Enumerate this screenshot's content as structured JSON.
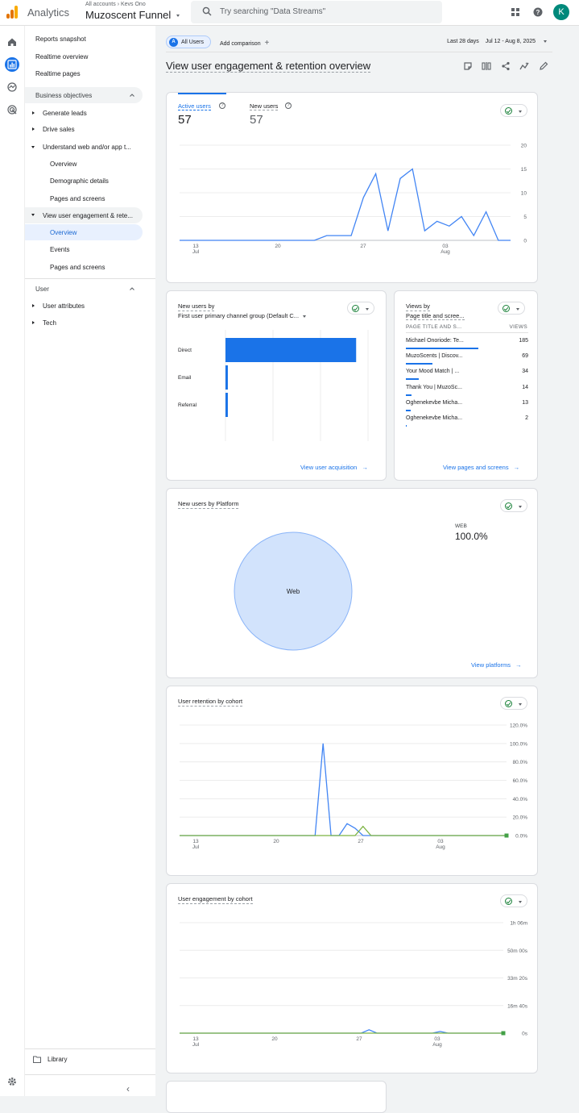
{
  "app": {
    "name": "Analytics",
    "breadcrumb": [
      "All accounts",
      "Kevs Ono"
    ],
    "property": "Muzoscent Funnel",
    "search_placeholder": "Try searching \"Data Streams\"",
    "avatar_letter": "K",
    "logo_colors": [
      "#f9ab00",
      "#e37400",
      "#e37400"
    ]
  },
  "nav": {
    "top_items": [
      "Reports snapshot",
      "Realtime overview",
      "Realtime pages"
    ],
    "business_header": "Business objectives",
    "business_items": [
      "Generate leads",
      "Drive sales",
      "Understand web and/or app t..."
    ],
    "understand_children": [
      "Overview",
      "Demographic details",
      "Pages and screens"
    ],
    "engagement_label": "View user engagement & rete...",
    "engagement_children": [
      "Overview",
      "Events",
      "Pages and screens"
    ],
    "user_header": "User",
    "user_items": [
      "User attributes",
      "Tech"
    ],
    "library": "Library"
  },
  "toolbar": {
    "segment_letter": "A",
    "segment_label": "All Users",
    "add_comparison": "Add comparison",
    "date_label": "Last 28 days",
    "date_range": "Jul 12 - Aug 8, 2025",
    "page_title": "View user engagement & retention overview"
  },
  "overview_card": {
    "metrics": [
      {
        "label": "Active users",
        "value": "57"
      },
      {
        "label": "New users",
        "value": "57"
      }
    ]
  },
  "new_users_card": {
    "title": "New users by",
    "dimension": "First user primary channel group (Default C...",
    "link": "View user acquisition"
  },
  "views_card": {
    "title": "Views by",
    "dimension": "Page title and scree...",
    "col_name": "PAGE TITLE AND S...",
    "col_value": "VIEWS",
    "rows": [
      {
        "name": "Michael Onoriode: Te...",
        "value": "185",
        "share": 1.0
      },
      {
        "name": "MuzoScents | Discov...",
        "value": "69",
        "share": 0.37
      },
      {
        "name": "Your Mood Match | ...",
        "value": "34",
        "share": 0.18
      },
      {
        "name": "Thank You | MuzoSc...",
        "value": "14",
        "share": 0.08
      },
      {
        "name": "Oghenekevbe Micha...",
        "value": "13",
        "share": 0.07
      },
      {
        "name": "Oghenekevbe Micha...",
        "value": "2",
        "share": 0.01
      }
    ],
    "link": "View pages and screens"
  },
  "platform_card": {
    "title": "New users by Platform",
    "legend_label": "WEB",
    "legend_value": "100.0%",
    "slice_label": "Web",
    "link": "View platforms"
  },
  "retention_card": {
    "title": "User retention by cohort"
  },
  "engagement_card": {
    "title": "User engagement by cohort"
  },
  "colors": {
    "blue": "#1a73e8",
    "line_blue": "#4285f4",
    "green": "#7cb342",
    "pie_fill": "#d2e3fc",
    "pie_stroke": "#8ab4f8"
  },
  "chart_data": [
    {
      "type": "line",
      "title": "Active users",
      "x": [
        "Jul 12",
        "Jul 13",
        "Jul 14",
        "Jul 15",
        "Jul 16",
        "Jul 17",
        "Jul 18",
        "Jul 19",
        "Jul 20",
        "Jul 21",
        "Jul 22",
        "Jul 23",
        "Jul 24",
        "Jul 25",
        "Jul 26",
        "Jul 27",
        "Jul 28",
        "Jul 29",
        "Jul 30",
        "Jul 31",
        "Aug 1",
        "Aug 2",
        "Aug 3",
        "Aug 4",
        "Aug 5",
        "Aug 6",
        "Aug 7",
        "Aug 8"
      ],
      "series": [
        {
          "name": "Active users",
          "values": [
            0,
            0,
            0,
            0,
            0,
            0,
            0,
            0,
            0,
            0,
            0,
            0,
            1,
            1,
            1,
            9,
            14,
            2,
            13,
            15,
            2,
            4,
            3,
            5,
            1,
            6,
            0,
            0
          ]
        }
      ],
      "ylim": [
        0,
        20
      ],
      "y_ticks": [
        "20",
        "15",
        "10",
        "5",
        "0"
      ],
      "x_ticks": [
        {
          "day": "13",
          "month": "Jul",
          "index": 1
        },
        {
          "day": "20",
          "index": 8
        },
        {
          "day": "27",
          "index": 15
        },
        {
          "day": "03",
          "month": "Aug",
          "index": 22
        }
      ]
    },
    {
      "type": "bar",
      "title": "New users by First user primary channel group (Default C...",
      "orientation": "horizontal",
      "categories": [
        "Direct",
        "Email",
        "Referral"
      ],
      "values": [
        55,
        1,
        1
      ],
      "xlim": [
        0,
        60
      ],
      "x_ticks": [
        "0",
        "20",
        "40",
        "60"
      ]
    },
    {
      "type": "pie",
      "title": "New users by Platform",
      "categories": [
        "Web"
      ],
      "values": [
        100.0
      ]
    },
    {
      "type": "line",
      "title": "User retention by cohort",
      "x_count": 28,
      "series": [
        {
          "values": [
            0,
            0,
            0,
            0,
            0,
            0,
            0,
            0,
            0,
            0,
            0,
            0,
            0,
            0,
            0,
            0,
            0,
            0,
            100,
            0,
            0,
            13,
            8,
            0,
            0,
            0,
            0,
            0,
            0,
            0,
            0,
            0,
            0,
            0,
            0,
            0,
            0,
            0,
            0,
            0,
            0,
            0
          ]
        },
        {
          "values": [
            0,
            0,
            0,
            0,
            0,
            0,
            0,
            0,
            0,
            0,
            0,
            0,
            0,
            0,
            0,
            0,
            0,
            0,
            0,
            0,
            0,
            0,
            0,
            10,
            0,
            0,
            0,
            0,
            0,
            0,
            0,
            0,
            0,
            0,
            0,
            0,
            0,
            0,
            0,
            0,
            0,
            0
          ]
        }
      ],
      "ylim": [
        0,
        120
      ],
      "y_ticks": [
        "120.0%",
        "100.0%",
        "80.0%",
        "60.0%",
        "40.0%",
        "20.0%",
        "0.0%"
      ],
      "x_ticks": [
        {
          "day": "13",
          "month": "Jul"
        },
        {
          "day": "20"
        },
        {
          "day": "27"
        },
        {
          "day": "03",
          "month": "Aug"
        }
      ]
    },
    {
      "type": "line",
      "title": "User engagement by cohort",
      "series": [
        {
          "values": [
            0,
            0,
            0,
            0,
            0,
            0,
            0,
            0,
            0,
            0,
            0,
            0,
            0,
            0,
            0,
            0,
            0,
            0,
            0,
            0,
            0,
            0,
            0,
            0,
            2,
            0,
            0,
            0,
            0,
            0,
            0,
            0,
            0,
            1,
            0,
            0,
            0,
            0,
            0,
            0,
            0,
            0
          ]
        },
        {
          "values": [
            0,
            0,
            0,
            0,
            0,
            0,
            0,
            0,
            0,
            0,
            0,
            0,
            0,
            0,
            0,
            0,
            0,
            0,
            0,
            0,
            0,
            0,
            0,
            0,
            0,
            0,
            0,
            0,
            0,
            0,
            0,
            0,
            0,
            0,
            0,
            0,
            0,
            0,
            0,
            0,
            0,
            0,
            0,
            0,
            0,
            0,
            0,
            0,
            0,
            0,
            0,
            0,
            0,
            0,
            0,
            0,
            0,
            0,
            0,
            0,
            0,
            0,
            0,
            0,
            0,
            0,
            0,
            0,
            0,
            0,
            0,
            0,
            0,
            0,
            0,
            0,
            0,
            0,
            0,
            0,
            0,
            0,
            0,
            0,
            0,
            0,
            0,
            0,
            0,
            0,
            0,
            0,
            0,
            0,
            0,
            0,
            0,
            0,
            0,
            0,
            0,
            0,
            0,
            0,
            0,
            0
          ]
        }
      ],
      "ylim": [
        0,
        66
      ],
      "y_ticks": [
        "1h 06m",
        "50m 00s",
        "33m 20s",
        "16m 40s",
        "0s"
      ],
      "x_ticks": [
        {
          "day": "13",
          "month": "Jul"
        },
        {
          "day": "20"
        },
        {
          "day": "27"
        },
        {
          "day": "03",
          "month": "Aug"
        }
      ]
    }
  ]
}
